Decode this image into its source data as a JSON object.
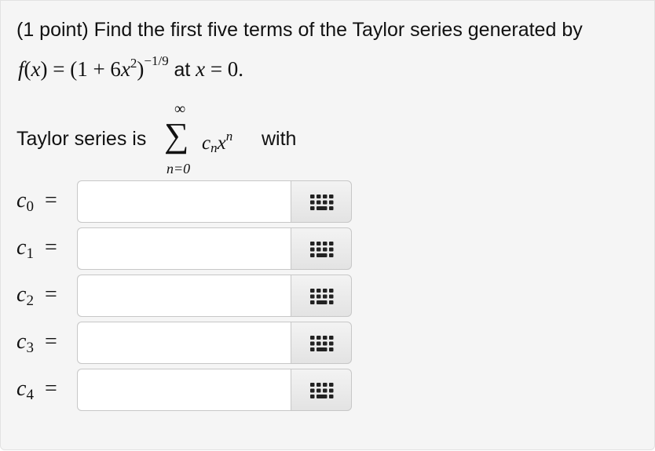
{
  "question": {
    "points": "(1 point)",
    "prompt": "Find the first five terms of the Taylor series generated by",
    "func_lhs": "f",
    "func_x": "x",
    "func_rhs_base": "(1 + 6",
    "func_rhs_var": "x",
    "func_square": "2",
    "func_close": ")",
    "func_exponent": "−1/9",
    "at_word": "at",
    "point_var": "x",
    "point_value": "= 0."
  },
  "series": {
    "label": "Taylor series is",
    "upper_limit": "∞",
    "sigma": "∑",
    "lower_limit": "n=0",
    "coef": "c",
    "coef_sub": "n",
    "var": "x",
    "var_power": "n",
    "with_word": "with"
  },
  "answers": [
    {
      "coef": "c",
      "subscript": "0",
      "equals": "=",
      "value": ""
    },
    {
      "coef": "c",
      "subscript": "1",
      "equals": "=",
      "value": ""
    },
    {
      "coef": "c",
      "subscript": "2",
      "equals": "=",
      "value": ""
    },
    {
      "coef": "c",
      "subscript": "3",
      "equals": "=",
      "value": ""
    },
    {
      "coef": "c",
      "subscript": "4",
      "equals": "=",
      "value": ""
    }
  ],
  "icons": {
    "keypad": "keypad-icon"
  }
}
